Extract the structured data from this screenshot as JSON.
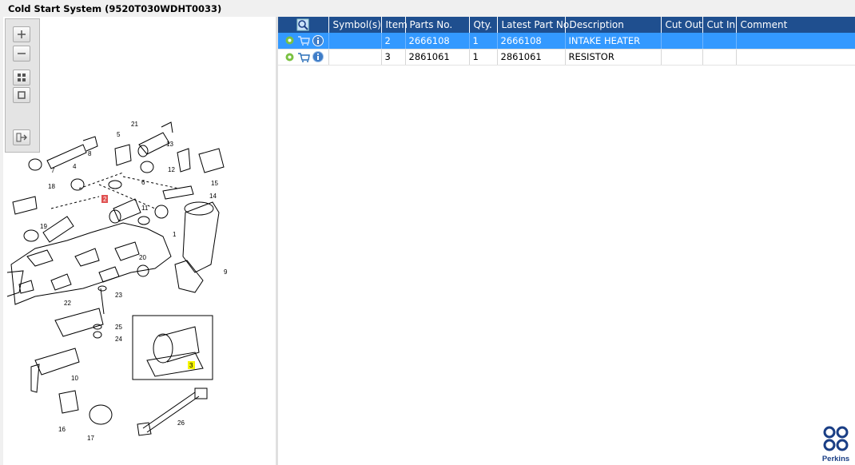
{
  "window": {
    "title": "Cold Start System (9520T030WDHT0033)"
  },
  "toolbar": {
    "zoom_in": "zoom-in-icon",
    "zoom_out": "zoom-out-icon",
    "fit": "fit-to-window-icon",
    "actual": "actual-size-icon",
    "export": "export-icon"
  },
  "diagram": {
    "labels": [
      "1",
      "2",
      "3",
      "4",
      "5",
      "6",
      "7",
      "8",
      "9",
      "10",
      "11",
      "12",
      "13",
      "14",
      "15",
      "16",
      "17",
      "18",
      "19",
      "20",
      "21",
      "22",
      "23",
      "24",
      "25",
      "26"
    ],
    "highlight_red": "2",
    "highlight_yellow": "3"
  },
  "table": {
    "columns": [
      "Symbol(s)",
      "Item",
      "Parts No.",
      "Qty.",
      "Latest Part No.",
      "Description",
      "Cut Out",
      "Cut In",
      "Comment"
    ],
    "rows": [
      {
        "item": "2",
        "parts_no": "2666108",
        "qty": "1",
        "latest": "2666108",
        "description": "INTAKE HEATER",
        "cut_out": "",
        "cut_in": "",
        "comment": "",
        "selected": true
      },
      {
        "item": "3",
        "parts_no": "2861061",
        "qty": "1",
        "latest": "2861061",
        "description": "RESISTOR",
        "cut_out": "",
        "cut_in": "",
        "comment": "",
        "selected": false
      }
    ]
  },
  "brand": {
    "name": "Perkins",
    "color": "#1a3e85"
  },
  "colors": {
    "header": "#1f4f8f",
    "selection": "#3399ff"
  }
}
